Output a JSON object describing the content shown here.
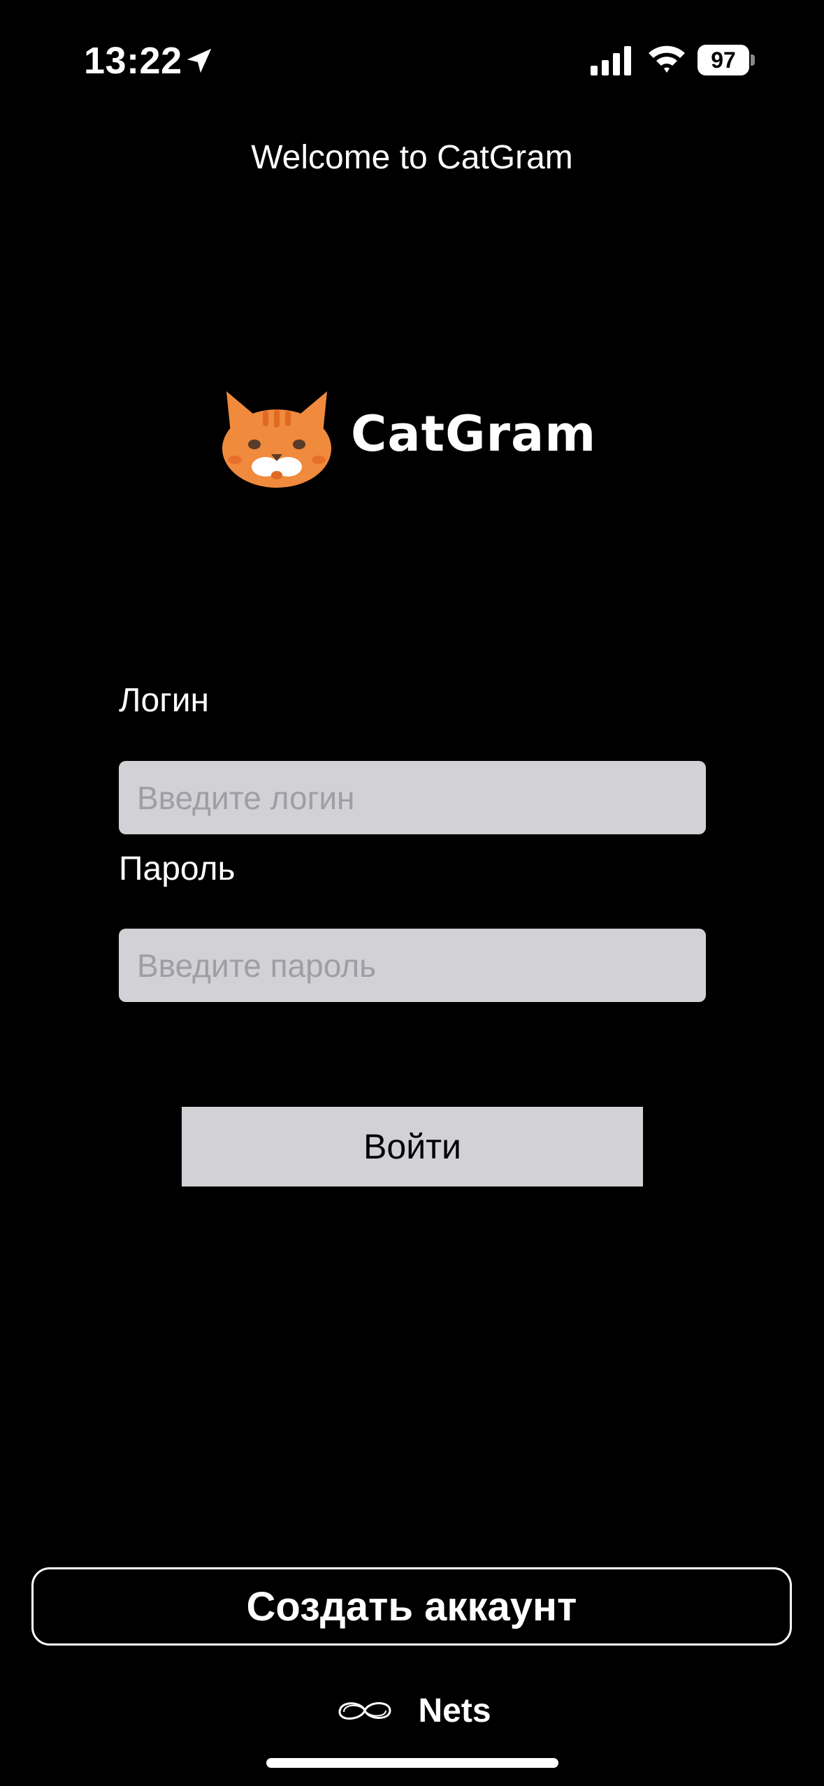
{
  "status_bar": {
    "time": "13:22",
    "battery": "97",
    "icons": [
      "location-arrow-icon",
      "cellular-signal-icon",
      "wifi-icon",
      "battery-icon"
    ]
  },
  "header": {
    "title": "Welcome to CatGram"
  },
  "logo": {
    "text": "CatGram",
    "icon": "cat-face-icon",
    "color": "#f08a3c"
  },
  "form": {
    "login_label": "Логин",
    "login_placeholder": "Введите логин",
    "login_value": "",
    "password_label": "Пароль",
    "password_placeholder": "Введите пароль",
    "password_value": "",
    "submit_label": "Войти"
  },
  "create_account": {
    "label": "Создать аккаунт"
  },
  "footer": {
    "brand": "Nets",
    "icon": "nets-logo-icon"
  },
  "colors": {
    "background": "#000000",
    "input_bg": "#d1d1d6",
    "placeholder": "#9e9ea4",
    "text": "#ffffff"
  }
}
